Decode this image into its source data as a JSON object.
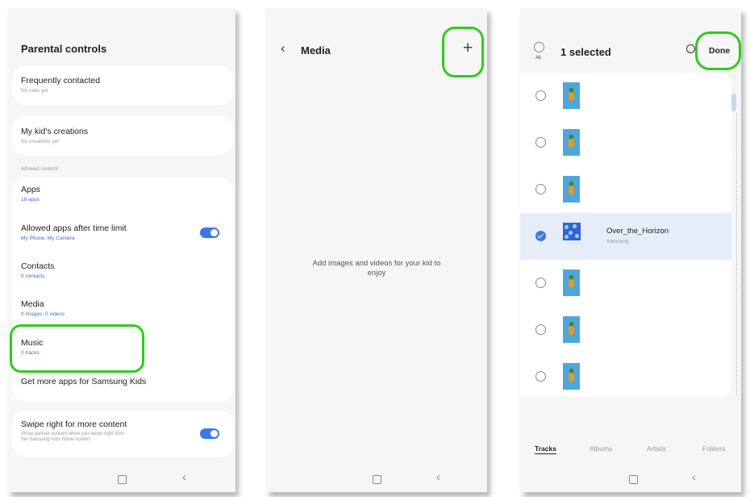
{
  "colors": {
    "highlight": "#2ecc1d",
    "accent": "#3b78e8",
    "screen_bg": "#f6f6f6",
    "card_bg": "#ffffff"
  },
  "screen1": {
    "title": "Parental controls",
    "frequently_contacted": {
      "title": "Frequently contacted",
      "subtitle": "No calls yet"
    },
    "creations": {
      "title": "My kid's creations",
      "subtitle": "No creations yet"
    },
    "section_label": "Allowed content",
    "apps": {
      "title": "Apps",
      "subtitle": "18 apps"
    },
    "allowed_after_limit": {
      "title": "Allowed apps after time limit",
      "subtitle": "My Phone, My Camera",
      "toggle_on": true
    },
    "contacts": {
      "title": "Contacts",
      "subtitle": "0 contacts"
    },
    "media": {
      "title": "Media",
      "subtitle": "0 images, 0 videos"
    },
    "music": {
      "title": "Music",
      "subtitle": "0 tracks"
    },
    "get_more": {
      "title": "Get more apps for Samsung Kids"
    },
    "swipe": {
      "title": "Swipe right for more content",
      "subtitle_line1": "Show partner content when you swipe right from",
      "subtitle_line2": "the Samsung Kids home screen.",
      "toggle_on": true
    },
    "nav": {
      "home_icon": "home-square-icon",
      "back_icon": "back-chevron-icon",
      "back_glyph": "‹"
    }
  },
  "screen2": {
    "back_glyph": "‹",
    "title": "Media",
    "add_glyph": "+",
    "empty_line1": "Add images and videos for your kid to",
    "empty_line2": "enjoy",
    "nav": {
      "back_glyph": "‹"
    }
  },
  "screen3": {
    "all_label": "All",
    "selected_text": "1 selected",
    "done_label": "Done",
    "search_icon": "search-icon",
    "track": {
      "title": "Over_the_Horizon",
      "artist": "Samsung"
    },
    "tabs": [
      "Tracks",
      "Albums",
      "Artists",
      "Folders"
    ],
    "active_tab": "Tracks",
    "nav": {
      "back_glyph": "‹"
    }
  }
}
